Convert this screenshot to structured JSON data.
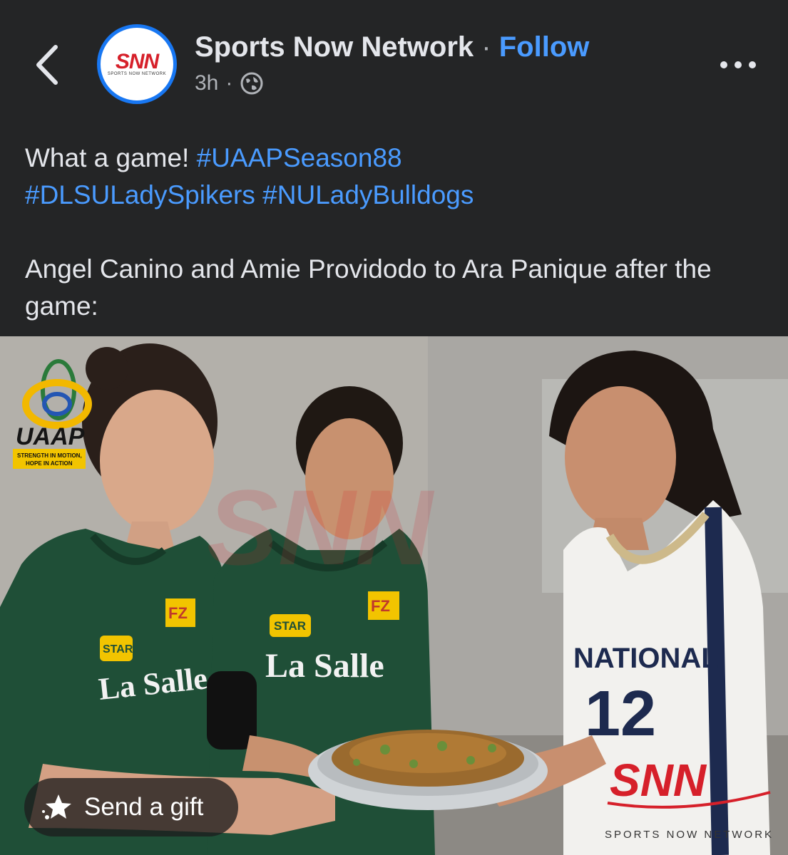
{
  "header": {
    "page_name": "Sports Now Network",
    "separator": "·",
    "follow_label": "Follow",
    "timestamp": "3h",
    "meta_separator": "·",
    "avatar_logo": "SNN",
    "avatar_subtitle": "SPORTS NOW NETWORK",
    "icons": {
      "back": "chevron-left-icon",
      "privacy": "globe-icon",
      "more": "more-horizontal-icon"
    }
  },
  "post": {
    "caption_intro": "What a game!",
    "hashtags": [
      "#UAAPSeason88",
      "#DLSULadySpikers",
      "#NULadyBulldogs"
    ],
    "caption_body": "Angel Canino and Amie Providodo to Ara Panique after the game:"
  },
  "photo": {
    "uaap_logo_text": "UAAP",
    "uaap_tagline_1": "STRENGTH IN MOTION,",
    "uaap_tagline_2": "HOPE IN ACTION",
    "jersey_left_team": "La Salle",
    "jersey_middle_team": "La Salle",
    "jersey_right_team": "NATIONAL",
    "jersey_right_number": "12",
    "sponsor_fz": "FZ",
    "sponsor_star": "STAR",
    "watermark_logo": "SNN",
    "watermark_text": "SPORTS NOW NETWORK"
  },
  "gift_button": {
    "label": "Send a gift",
    "icon": "gift-sparkle-icon"
  },
  "colors": {
    "background": "#242526",
    "link": "#4a9bff",
    "avatar_ring": "#1877f2",
    "green_jersey": "#1f4f37",
    "brand_red": "#d6202a"
  }
}
